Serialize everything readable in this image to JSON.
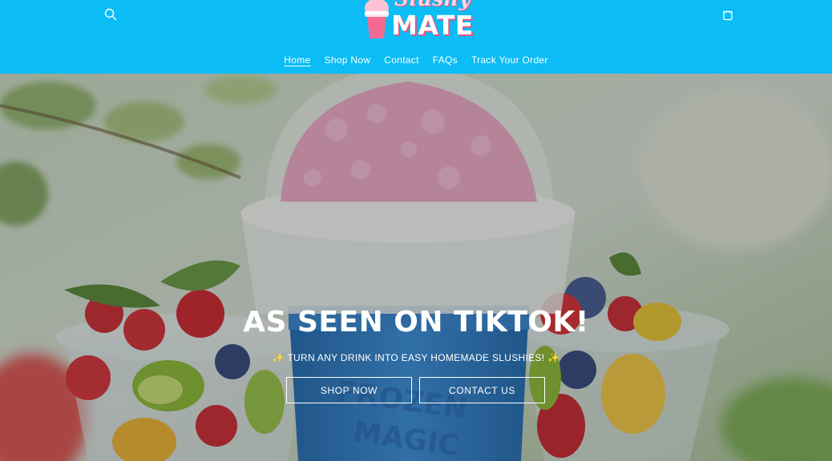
{
  "header": {
    "logo": {
      "script_text": "Slushy",
      "main_text": "MATE"
    },
    "search_icon": "search-icon",
    "cart_icon": "cart-icon"
  },
  "nav": {
    "items": [
      {
        "label": "Home",
        "active": true
      },
      {
        "label": "Shop Now"
      },
      {
        "label": "Contact"
      },
      {
        "label": "FAQs"
      },
      {
        "label": "Track Your Order"
      }
    ]
  },
  "hero": {
    "title": "AS SEEN ON TIKTOK!",
    "subtitle": "✨ TURN ANY DRINK INTO EASY HOMEMADE SLUSHIES! ✨",
    "primary_button": "SHOP NOW",
    "secondary_button": "CONTACT US"
  },
  "colors": {
    "header_bg": "#0bbcf5",
    "logo_accent": "#e9557f",
    "text": "#ffffff"
  }
}
